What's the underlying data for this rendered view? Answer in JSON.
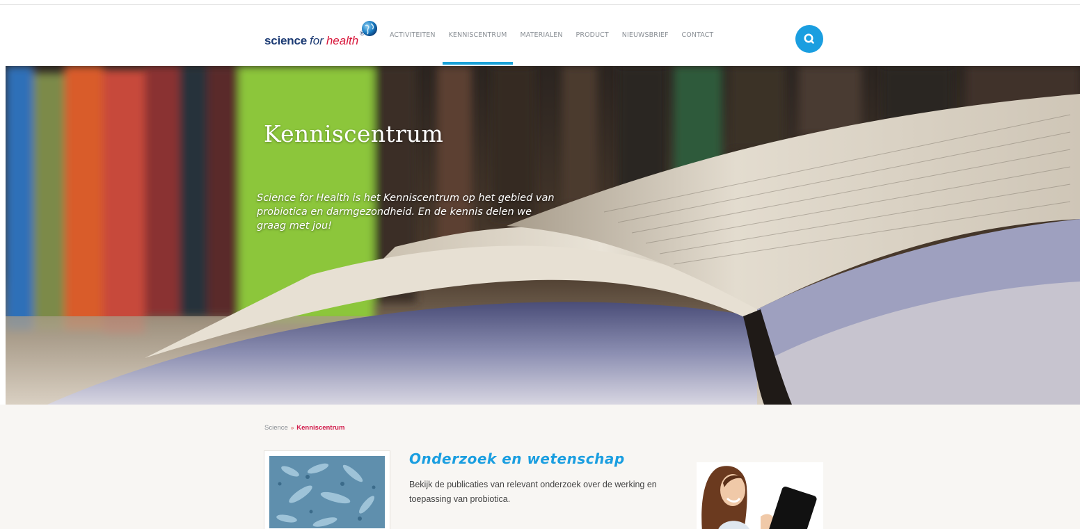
{
  "brand": {
    "science": "science",
    "for": "for",
    "health": "health",
    "reg": "®"
  },
  "nav": {
    "items": [
      {
        "label": "ACTIVITEITEN",
        "active": false
      },
      {
        "label": "KENNISCENTRUM",
        "active": true
      },
      {
        "label": "MATERIALEN",
        "active": false
      },
      {
        "label": "PRODUCT",
        "active": false
      },
      {
        "label": "NIEUWSBRIEF",
        "active": false
      },
      {
        "label": "CONTACT",
        "active": false
      }
    ]
  },
  "hero": {
    "title": "Kenniscentrum",
    "text": "Science for Health is het Kenniscentrum op het gebied van probiotica en darmgezondheid. En de kennis delen we graag met jou!"
  },
  "breadcrumb": {
    "root": "Science",
    "separator": "»",
    "current": "Kenniscentrum"
  },
  "section": {
    "title": "Onderzoek en wetenschap",
    "description": "Bekijk de publicaties van relevant onderzoek over de werking en toepassing van probiotica."
  },
  "colors": {
    "accent": "#1a9ee0",
    "brand_navy": "#1b3a73",
    "brand_red": "#d8163a",
    "breadcrumb_active": "#d11a4a"
  },
  "icons": {
    "search": "search-icon",
    "globe": "globe-icon"
  }
}
